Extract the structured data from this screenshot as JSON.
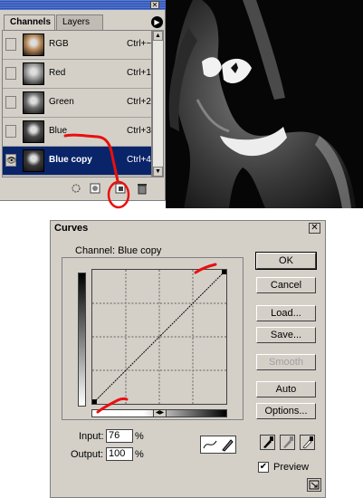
{
  "channels_palette": {
    "tabs": [
      {
        "label": "Channels",
        "active": true
      },
      {
        "label": "Layers",
        "active": false
      }
    ],
    "channels": [
      {
        "name": "RGB",
        "shortcut": "Ctrl+~",
        "visible": false,
        "selected": false,
        "thumb": "#b98a5a"
      },
      {
        "name": "Red",
        "shortcut": "Ctrl+1",
        "visible": false,
        "selected": false,
        "thumb": "#9a9a9a"
      },
      {
        "name": "Green",
        "shortcut": "Ctrl+2",
        "visible": false,
        "selected": false,
        "thumb": "#6e6e6e"
      },
      {
        "name": "Blue",
        "shortcut": "Ctrl+3",
        "visible": false,
        "selected": false,
        "thumb": "#4a4a4a"
      },
      {
        "name": "Blue copy",
        "shortcut": "Ctrl+4",
        "visible": true,
        "selected": true,
        "thumb": "#3a3a3a"
      }
    ],
    "bottom_icons": [
      "load-selection-icon",
      "save-selection-icon",
      "new-channel-icon",
      "trash-icon"
    ]
  },
  "curves": {
    "title": "Curves",
    "channel_label": "Channel:",
    "channel_value": "Blue copy",
    "input_label": "Input:",
    "input_value": "76",
    "output_label": "Output:",
    "output_value": "100",
    "percent": "%",
    "buttons": {
      "ok": "OK",
      "cancel": "Cancel",
      "load": "Load...",
      "save": "Save...",
      "smooth": "Smooth",
      "auto": "Auto",
      "options": "Options..."
    },
    "preview_label": "Preview",
    "preview_checked": true,
    "curve_points": [
      [
        0,
        0
      ],
      [
        100,
        100
      ]
    ]
  },
  "colors": {
    "annotation_red": "#e81010",
    "selection_blue": "#0a246a",
    "dialog_grey": "#d4d0c8"
  }
}
